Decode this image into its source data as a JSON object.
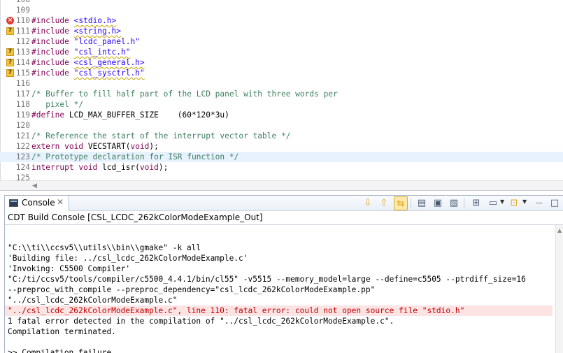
{
  "editor": {
    "lines": [
      {
        "no": "108",
        "marker": "",
        "segments": [],
        "partial": true
      },
      {
        "no": "109",
        "marker": "",
        "segments": []
      },
      {
        "no": "110",
        "marker": "error",
        "segments": [
          {
            "t": "#include ",
            "c": "kw"
          },
          {
            "t": "<stdio.h>",
            "c": "str",
            "sq": true
          }
        ]
      },
      {
        "no": "111",
        "marker": "warning",
        "segments": [
          {
            "t": "#include ",
            "c": "kw"
          },
          {
            "t": "<string.h>",
            "c": "str",
            "sq": true
          }
        ]
      },
      {
        "no": "112",
        "marker": "",
        "segments": [
          {
            "t": "#include ",
            "c": "kw"
          },
          {
            "t": "\"lcdc_panel.h\"",
            "c": "str"
          }
        ]
      },
      {
        "no": "113",
        "marker": "warning",
        "segments": [
          {
            "t": "#include ",
            "c": "kw"
          },
          {
            "t": "\"csl_intc.h\"",
            "c": "str",
            "sq": true
          }
        ]
      },
      {
        "no": "114",
        "marker": "warning",
        "segments": [
          {
            "t": "#include ",
            "c": "kw"
          },
          {
            "t": "<csl_general.h>",
            "c": "str",
            "sq": true
          }
        ]
      },
      {
        "no": "115",
        "marker": "warning",
        "segments": [
          {
            "t": "#include ",
            "c": "kw"
          },
          {
            "t": "\"csl_sysctrl.h\"",
            "c": "str",
            "sq": true
          }
        ]
      },
      {
        "no": "116",
        "marker": "",
        "segments": []
      },
      {
        "no": "117",
        "marker": "",
        "segments": [
          {
            "t": "/* Buffer to fill half part of the LCD panel with three words per",
            "c": "cm"
          }
        ]
      },
      {
        "no": "118",
        "marker": "",
        "segments": [
          {
            "t": "   pixel */",
            "c": "cm"
          }
        ]
      },
      {
        "no": "119",
        "marker": "",
        "segments": [
          {
            "t": "#define",
            "c": "kw"
          },
          {
            "t": " LCD_MAX_BUFFER_SIZE    (60*120*3u)",
            "c": "plain"
          }
        ]
      },
      {
        "no": "120",
        "marker": "",
        "segments": []
      },
      {
        "no": "121",
        "marker": "",
        "segments": [
          {
            "t": "/* Reference the start of the interrupt vector table */",
            "c": "cm"
          }
        ]
      },
      {
        "no": "122",
        "marker": "",
        "segments": [
          {
            "t": "extern void",
            "c": "kw"
          },
          {
            "t": " VECSTART(",
            "c": "plain"
          },
          {
            "t": "void",
            "c": "kw"
          },
          {
            "t": ");",
            "c": "plain"
          }
        ]
      },
      {
        "no": "123",
        "marker": "",
        "highlight": true,
        "segments": [
          {
            "t": "/* Prototype declaration for ISR function */",
            "c": "cm"
          }
        ]
      },
      {
        "no": "124",
        "marker": "",
        "segments": [
          {
            "t": "interrupt void",
            "c": "kw"
          },
          {
            "t": " lcd_isr(",
            "c": "plain"
          },
          {
            "t": "void",
            "c": "kw"
          },
          {
            "t": ");",
            "c": "plain"
          }
        ]
      },
      {
        "no": "125",
        "marker": "",
        "segments": [],
        "partial": true
      }
    ]
  },
  "console": {
    "tab_label": "Console",
    "close_glyph": "✕",
    "subtitle": "CDT Build Console [CSL_LCDC_262kColorModeExample_Out]",
    "toolbar": {
      "scroll_down": "⇩",
      "scroll_up": "⇧",
      "link_active": "⇆",
      "clear": "▤",
      "pin": "▣",
      "remove": "▧",
      "new_console": "⊞",
      "display_selected": "▭",
      "open_console": "⊡",
      "dropdown": "▼",
      "minimize": "—",
      "maximize": "□"
    },
    "output": [
      {
        "text": "",
        "err": false
      },
      {
        "text": "\"C:\\\\ti\\\\ccsv5\\\\utils\\\\bin\\\\gmake\" -k all",
        "err": false
      },
      {
        "text": "'Building file: ../csl_lcdc_262kColorModeExample.c'",
        "err": false
      },
      {
        "text": "'Invoking: C5500 Compiler'",
        "err": false
      },
      {
        "text": "\"C:/ti/ccsv5/tools/compiler/c5500_4.4.1/bin/cl55\" -v5515 --memory_model=large --define=c5505 --ptrdiff_size=16",
        "err": false
      },
      {
        "text": "--preproc_with_compile --preproc_dependency=\"csl_lcdc_262kColorModeExample.pp\"",
        "err": false
      },
      {
        "text": "\"../csl_lcdc_262kColorModeExample.c\"",
        "err": false
      },
      {
        "text": "\"../csl_lcdc_262kColorModeExample.c\", line 110: fatal error: could not open source file \"stdio.h\"",
        "err": true
      },
      {
        "text": "1 fatal error detected in the compilation of \"../csl_lcdc_262kColorModeExample.c\".",
        "err": false
      },
      {
        "text": "Compilation terminated.",
        "err": false
      },
      {
        "text": "",
        "err": false
      },
      {
        "text": ">> Compilation failure",
        "err": false
      }
    ]
  }
}
